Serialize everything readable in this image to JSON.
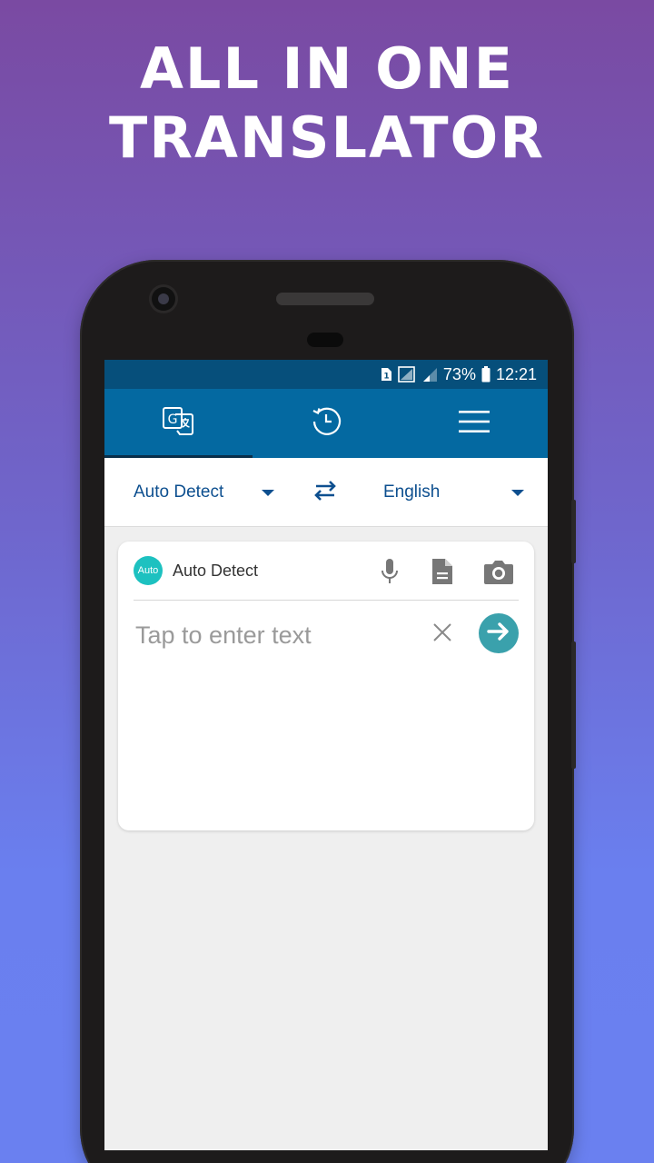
{
  "headline": {
    "line1": "ALL IN ONE",
    "line2": "TRANSLATOR"
  },
  "status_bar": {
    "sim_slot": "1",
    "battery_percent": "73%",
    "time": "12:21"
  },
  "tabs": [
    {
      "name": "translate",
      "icon": "translate-icon",
      "active": true
    },
    {
      "name": "history",
      "icon": "history-icon",
      "active": false
    },
    {
      "name": "menu",
      "icon": "hamburger-menu-icon",
      "active": false
    }
  ],
  "language_bar": {
    "source": "Auto Detect",
    "target": "English",
    "swap_icon": "swap-arrows-icon"
  },
  "input_card": {
    "badge": "Auto",
    "source_label": "Auto Detect",
    "placeholder": "Tap to enter text",
    "icons": [
      "microphone-icon",
      "document-icon",
      "camera-icon",
      "close-icon",
      "arrow-right-icon"
    ]
  },
  "colors": {
    "status_bar": "#064f7b",
    "app_bar": "#0469a1",
    "accent_text": "#0d4f8f",
    "badge": "#1dc1c0",
    "go_button": "#3aa1ac"
  }
}
